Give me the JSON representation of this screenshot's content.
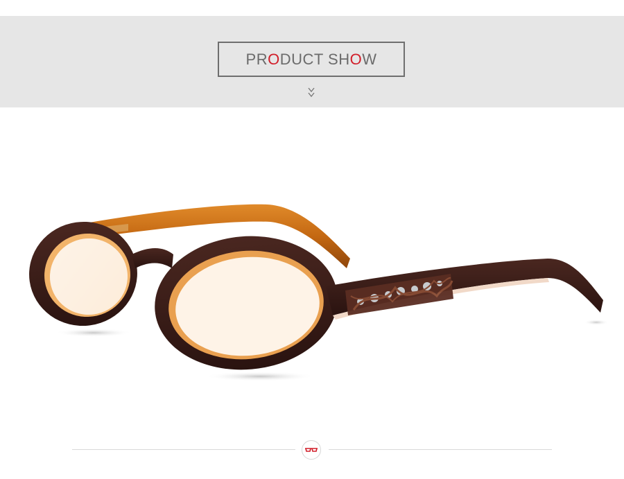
{
  "header": {
    "title_parts": [
      {
        "text": "PR",
        "accent": false
      },
      {
        "text": "O",
        "accent": true
      },
      {
        "text": "DUCT SH",
        "accent": false
      },
      {
        "text": "O",
        "accent": true
      },
      {
        "text": "W",
        "accent": false
      }
    ],
    "band_color": "#e6e6e6",
    "title_color": "#6b6b6b",
    "accent_color": "#d21f2a"
  },
  "icons": {
    "scroll_indicator": "double-chevron-down-icon",
    "footer_logo": "glasses-logo-icon"
  },
  "product": {
    "image": "eyeglasses-photo",
    "frame_color": "#3d1f1a",
    "temple_color": "#c76a12"
  }
}
